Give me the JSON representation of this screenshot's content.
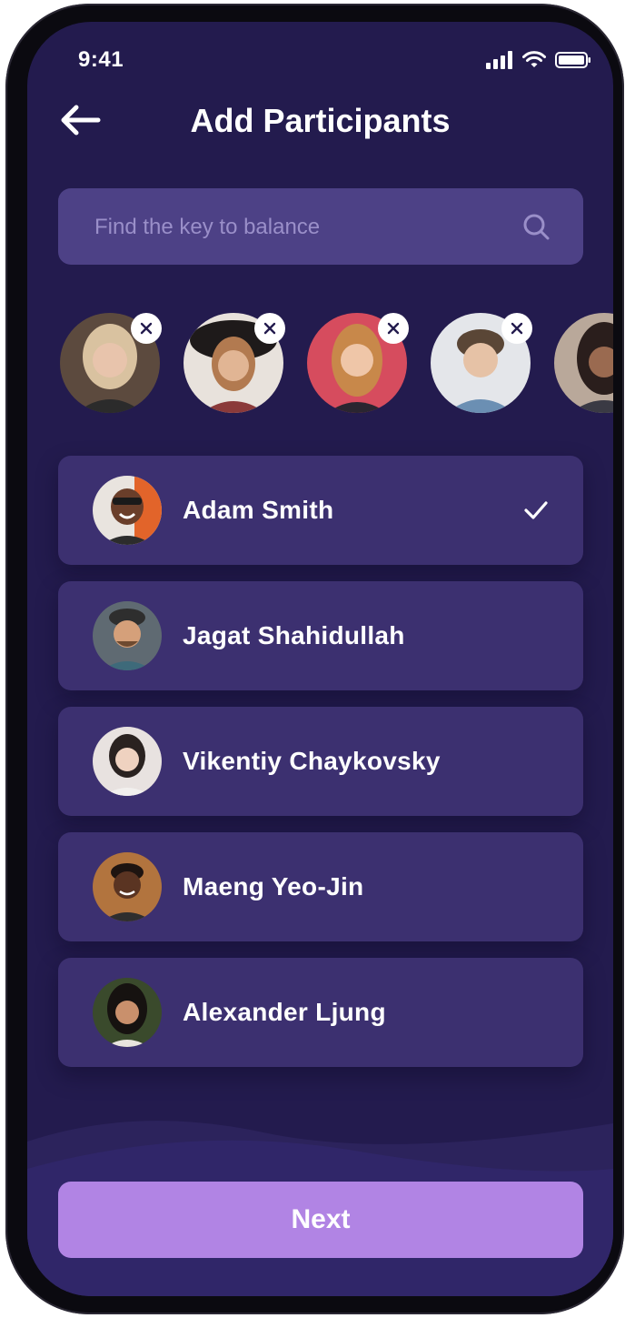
{
  "status_bar": {
    "time": "9:41"
  },
  "header": {
    "title": "Add Participants"
  },
  "search": {
    "placeholder": "Find the key to balance",
    "value": ""
  },
  "selected_participants": [
    {
      "name": "",
      "avatar_color": "#7a5a48"
    },
    {
      "name": "",
      "avatar_color": "#7d6652"
    },
    {
      "name": "",
      "avatar_color": "#c6535e"
    },
    {
      "name": "",
      "avatar_color": "#6e6c7c"
    },
    {
      "name": "",
      "avatar_color": "#5a4a44"
    }
  ],
  "contacts": [
    {
      "name": "Adam Smith",
      "selected": true,
      "avatar_color": "#d86a2a"
    },
    {
      "name": "Jagat Shahidullah",
      "selected": false,
      "avatar_color": "#4a5a66"
    },
    {
      "name": "Vikentiy Chaykovsky",
      "selected": false,
      "avatar_color": "#b6a8a2"
    },
    {
      "name": "Maeng Yeo-Jin",
      "selected": false,
      "avatar_color": "#a35a3a"
    },
    {
      "name": "Alexander Ljung",
      "selected": false,
      "avatar_color": "#3b4a30"
    }
  ],
  "footer": {
    "next_label": "Next"
  },
  "colors": {
    "background": "#231b4e",
    "card": "#3c3070",
    "search_bg": "#4d4186",
    "accent": "#b184e4",
    "text": "#ffffff"
  }
}
